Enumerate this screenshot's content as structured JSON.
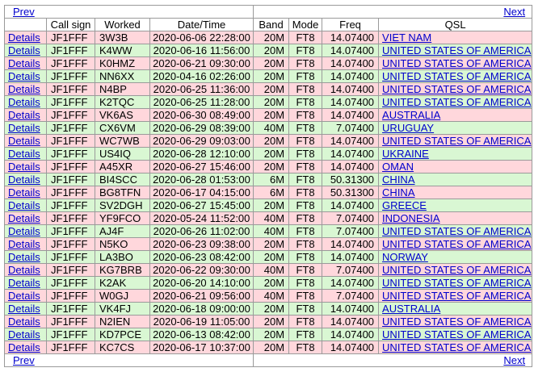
{
  "nav": {
    "prev_label": "Prev",
    "next_label": "Next"
  },
  "columns": [
    "",
    "Call sign",
    "Worked",
    "Date/Time",
    "Band",
    "Mode",
    "Freq",
    "QSL"
  ],
  "rows": [
    {
      "details": "Details",
      "call": "JF1FFF",
      "worked": "3W3B",
      "datetime": "2020-06-06 22:28:00",
      "band": "20M",
      "mode": "FT8",
      "freq": "14.07400",
      "qsl": "VIET NAM",
      "color": "pink"
    },
    {
      "details": "Details",
      "call": "JF1FFF",
      "worked": "K4WW",
      "datetime": "2020-06-16 11:56:00",
      "band": "20M",
      "mode": "FT8",
      "freq": "14.07400",
      "qsl": "UNITED STATES OF AMERICA",
      "color": "green"
    },
    {
      "details": "Details",
      "call": "JF1FFF",
      "worked": "K0HMZ",
      "datetime": "2020-06-21 09:30:00",
      "band": "20M",
      "mode": "FT8",
      "freq": "14.07400",
      "qsl": "UNITED STATES OF AMERICA",
      "color": "pink"
    },
    {
      "details": "Details",
      "call": "JF1FFF",
      "worked": "NN6XX",
      "datetime": "2020-04-16 02:26:00",
      "band": "20M",
      "mode": "FT8",
      "freq": "14.07400",
      "qsl": "UNITED STATES OF AMERICA",
      "color": "green"
    },
    {
      "details": "Details",
      "call": "JF1FFF",
      "worked": "N4BP",
      "datetime": "2020-06-25 11:36:00",
      "band": "20M",
      "mode": "FT8",
      "freq": "14.07400",
      "qsl": "UNITED STATES OF AMERICA",
      "color": "pink"
    },
    {
      "details": "Details",
      "call": "JF1FFF",
      "worked": "K2TQC",
      "datetime": "2020-06-25 11:28:00",
      "band": "20M",
      "mode": "FT8",
      "freq": "14.07400",
      "qsl": "UNITED STATES OF AMERICA",
      "color": "green"
    },
    {
      "details": "Details",
      "call": "JF1FFF",
      "worked": "VK6AS",
      "datetime": "2020-06-30 08:49:00",
      "band": "20M",
      "mode": "FT8",
      "freq": "14.07400",
      "qsl": "AUSTRALIA",
      "color": "pink"
    },
    {
      "details": "Details",
      "call": "JF1FFF",
      "worked": "CX6VM",
      "datetime": "2020-06-29 08:39:00",
      "band": "40M",
      "mode": "FT8",
      "freq": "7.07400",
      "qsl": "URUGUAY",
      "color": "green"
    },
    {
      "details": "Details",
      "call": "JF1FFF",
      "worked": "WC7WB",
      "datetime": "2020-06-29 09:03:00",
      "band": "20M",
      "mode": "FT8",
      "freq": "14.07400",
      "qsl": "UNITED STATES OF AMERICA",
      "color": "pink"
    },
    {
      "details": "Details",
      "call": "JF1FFF",
      "worked": "US4IQ",
      "datetime": "2020-06-28 12:10:00",
      "band": "20M",
      "mode": "FT8",
      "freq": "14.07400",
      "qsl": "UKRAINE",
      "color": "green"
    },
    {
      "details": "Details",
      "call": "JF1FFF",
      "worked": "A45XR",
      "datetime": "2020-06-27 15:46:00",
      "band": "20M",
      "mode": "FT8",
      "freq": "14.07400",
      "qsl": "OMAN",
      "color": "pink"
    },
    {
      "details": "Details",
      "call": "JF1FFF",
      "worked": "BI4SCC",
      "datetime": "2020-06-28 01:53:00",
      "band": "6M",
      "mode": "FT8",
      "freq": "50.31300",
      "qsl": "CHINA",
      "color": "green"
    },
    {
      "details": "Details",
      "call": "JF1FFF",
      "worked": "BG8TFN",
      "datetime": "2020-06-17 04:15:00",
      "band": "6M",
      "mode": "FT8",
      "freq": "50.31300",
      "qsl": "CHINA",
      "color": "pink"
    },
    {
      "details": "Details",
      "call": "JF1FFF",
      "worked": "SV2DGH",
      "datetime": "2020-06-27 15:45:00",
      "band": "20M",
      "mode": "FT8",
      "freq": "14.07400",
      "qsl": "GREECE",
      "color": "green"
    },
    {
      "details": "Details",
      "call": "JF1FFF",
      "worked": "YF9FCO",
      "datetime": "2020-05-24 11:52:00",
      "band": "40M",
      "mode": "FT8",
      "freq": "7.07400",
      "qsl": "INDONESIA",
      "color": "pink"
    },
    {
      "details": "Details",
      "call": "JF1FFF",
      "worked": "AJ4F",
      "datetime": "2020-06-26 11:02:00",
      "band": "40M",
      "mode": "FT8",
      "freq": "7.07400",
      "qsl": "UNITED STATES OF AMERICA",
      "color": "green"
    },
    {
      "details": "Details",
      "call": "JF1FFF",
      "worked": "N5KO",
      "datetime": "2020-06-23 09:38:00",
      "band": "20M",
      "mode": "FT8",
      "freq": "14.07400",
      "qsl": "UNITED STATES OF AMERICA",
      "color": "pink"
    },
    {
      "details": "Details",
      "call": "JF1FFF",
      "worked": "LA3BO",
      "datetime": "2020-06-23 08:42:00",
      "band": "20M",
      "mode": "FT8",
      "freq": "14.07400",
      "qsl": "NORWAY",
      "color": "green"
    },
    {
      "details": "Details",
      "call": "JF1FFF",
      "worked": "KG7BRB",
      "datetime": "2020-06-22 09:30:00",
      "band": "40M",
      "mode": "FT8",
      "freq": "7.07400",
      "qsl": "UNITED STATES OF AMERICA",
      "color": "pink"
    },
    {
      "details": "Details",
      "call": "JF1FFF",
      "worked": "K2AK",
      "datetime": "2020-06-20 14:10:00",
      "band": "20M",
      "mode": "FT8",
      "freq": "14.07400",
      "qsl": "UNITED STATES OF AMERICA",
      "color": "green"
    },
    {
      "details": "Details",
      "call": "JF1FFF",
      "worked": "W0GJ",
      "datetime": "2020-06-21 09:56:00",
      "band": "40M",
      "mode": "FT8",
      "freq": "7.07400",
      "qsl": "UNITED STATES OF AMERICA",
      "color": "pink"
    },
    {
      "details": "Details",
      "call": "JF1FFF",
      "worked": "VK4FJ",
      "datetime": "2020-06-18 09:00:00",
      "band": "20M",
      "mode": "FT8",
      "freq": "14.07400",
      "qsl": "AUSTRALIA",
      "color": "green"
    },
    {
      "details": "Details",
      "call": "JF1FFF",
      "worked": "N2IEN",
      "datetime": "2020-06-19 11:05:00",
      "band": "20M",
      "mode": "FT8",
      "freq": "14.07400",
      "qsl": "UNITED STATES OF AMERICA",
      "color": "pink"
    },
    {
      "details": "Details",
      "call": "JF1FFF",
      "worked": "KD7PCE",
      "datetime": "2020-06-13 08:42:00",
      "band": "20M",
      "mode": "FT8",
      "freq": "14.07400",
      "qsl": "UNITED STATES OF AMERICA",
      "color": "green"
    },
    {
      "details": "Details",
      "call": "JF1FFF",
      "worked": "KC7CS",
      "datetime": "2020-06-17 10:37:00",
      "band": "20M",
      "mode": "FT8",
      "freq": "14.07400",
      "qsl": "UNITED STATES OF AMERICA",
      "color": "pink"
    }
  ]
}
